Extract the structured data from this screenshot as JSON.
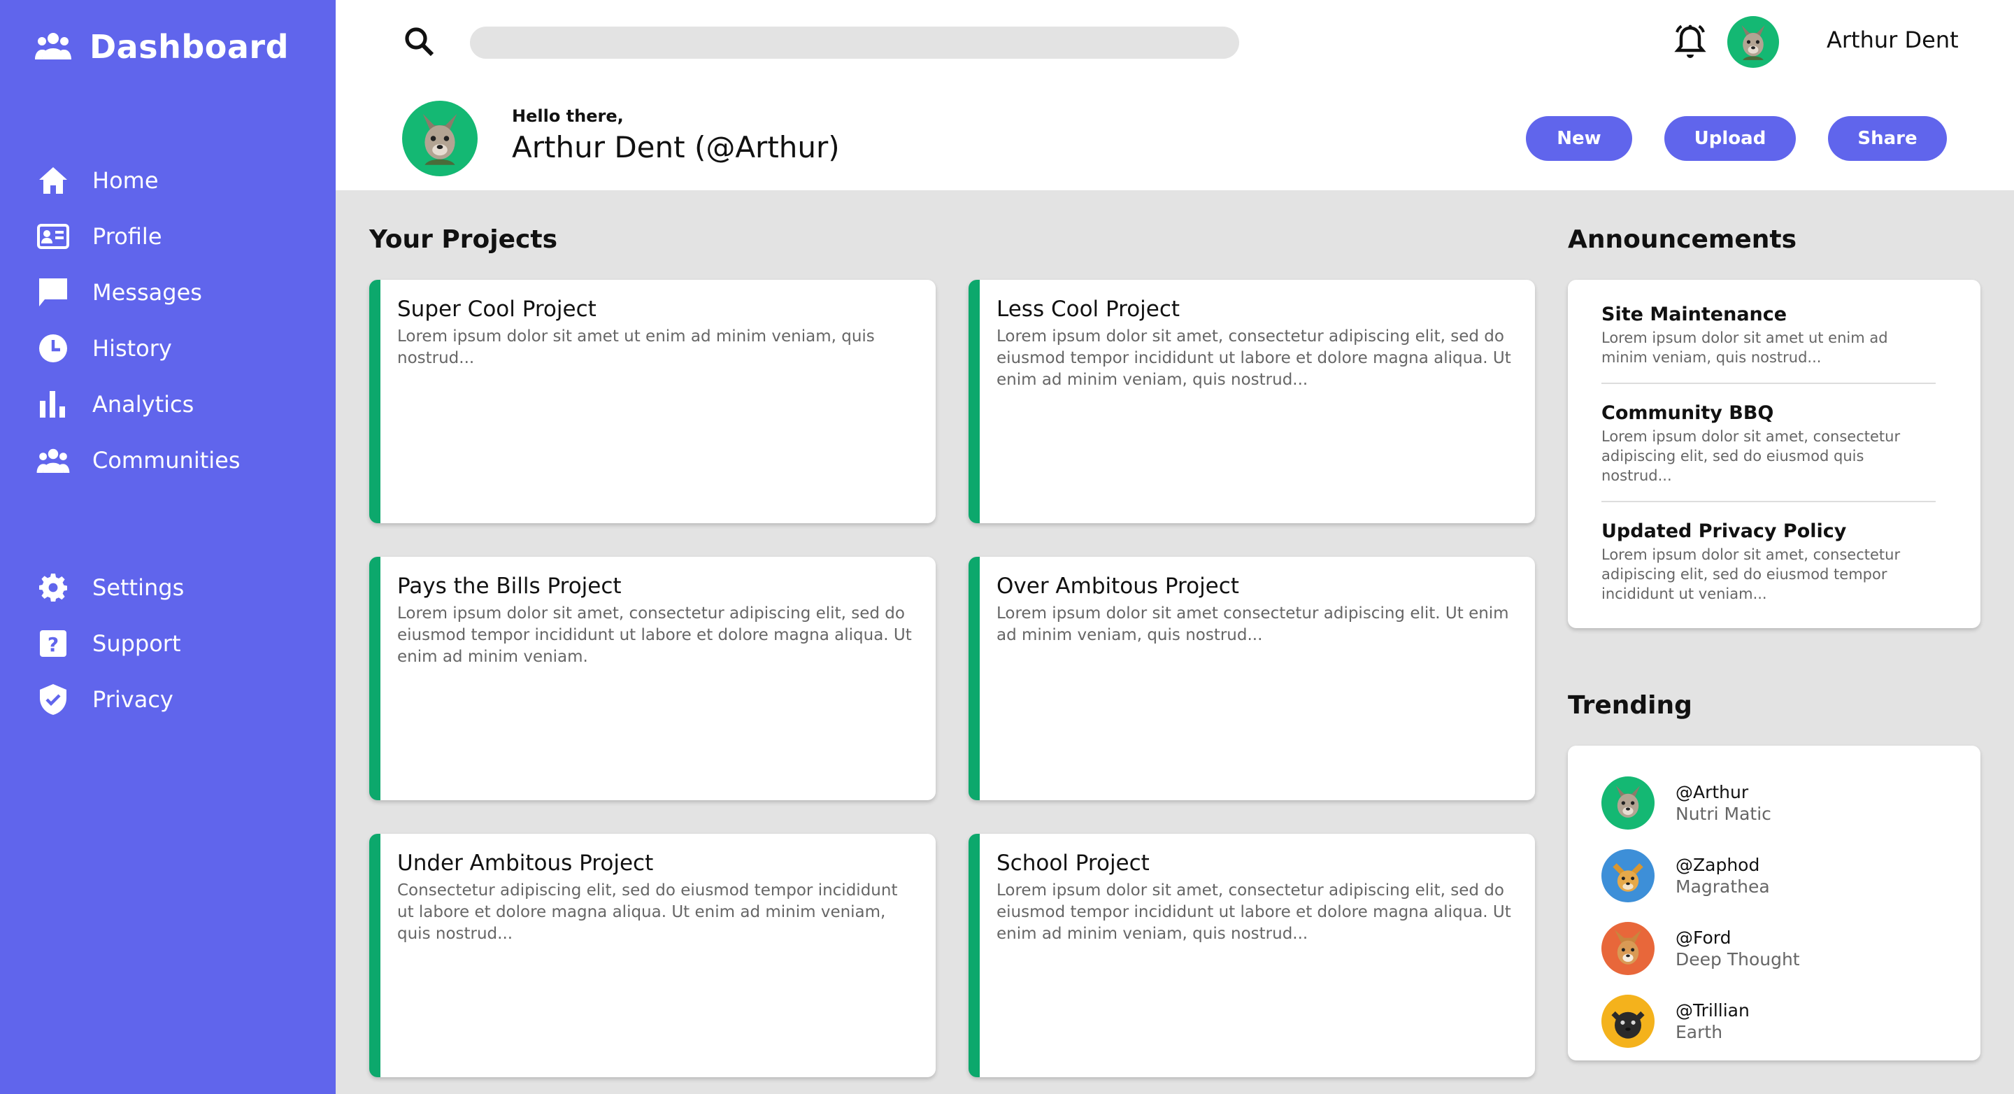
{
  "sidebar": {
    "brand": "Dashboard",
    "nav_top": [
      {
        "label": "Home",
        "icon": "home-icon"
      },
      {
        "label": "Profile",
        "icon": "profile-card-icon"
      },
      {
        "label": "Messages",
        "icon": "message-icon"
      },
      {
        "label": "History",
        "icon": "clock-icon"
      },
      {
        "label": "Analytics",
        "icon": "bar-chart-icon"
      },
      {
        "label": "Communities",
        "icon": "people-icon"
      }
    ],
    "nav_bottom": [
      {
        "label": "Settings",
        "icon": "gear-icon"
      },
      {
        "label": "Support",
        "icon": "help-icon"
      },
      {
        "label": "Privacy",
        "icon": "shield-icon"
      }
    ]
  },
  "header": {
    "search_placeholder": "",
    "username": "Arthur Dent",
    "greeting": "Hello there,",
    "full_name": "Arthur Dent (@Arthur)",
    "buttons": {
      "new": "New",
      "upload": "Upload",
      "share": "Share"
    }
  },
  "projects": {
    "title": "Your Projects",
    "items": [
      {
        "title": "Super Cool Project",
        "desc": "Lorem ipsum dolor sit amet ut enim ad minim veniam, quis nostrud..."
      },
      {
        "title": "Less Cool Project",
        "desc": "Lorem ipsum dolor sit amet, consectetur adipiscing elit, sed do eiusmod tempor incididunt ut labore et dolore magna aliqua. Ut enim ad minim veniam, quis nostrud..."
      },
      {
        "title": "Pays the Bills Project",
        "desc": "Lorem ipsum dolor sit amet, consectetur adipiscing elit, sed do eiusmod tempor incididunt ut labore et dolore magna aliqua. Ut enim ad minim veniam."
      },
      {
        "title": "Over Ambitous Project",
        "desc": "Lorem ipsum dolor sit amet consectetur adipiscing elit. Ut enim ad minim veniam, quis nostrud..."
      },
      {
        "title": "Under Ambitous Project",
        "desc": "Consectetur adipiscing elit, sed do eiusmod tempor incididunt ut labore et dolore magna aliqua. Ut enim ad minim veniam, quis nostrud..."
      },
      {
        "title": "School Project",
        "desc": "Lorem ipsum dolor sit amet, consectetur adipiscing elit, sed do eiusmod tempor incididunt ut labore et dolore magna aliqua. Ut enim ad minim veniam, quis nostrud..."
      }
    ]
  },
  "announcements": {
    "title": "Announcements",
    "items": [
      {
        "title": "Site Maintenance",
        "desc": "Lorem ipsum dolor sit amet ut enim ad minim veniam, quis nostrud..."
      },
      {
        "title": "Community BBQ",
        "desc": "Lorem ipsum dolor sit amet, consectetur adipiscing elit, sed do eiusmod quis nostrud..."
      },
      {
        "title": "Updated Privacy Policy",
        "desc": "Lorem ipsum dolor sit amet, consectetur adipiscing elit, sed do eiusmod tempor incididunt ut veniam..."
      }
    ]
  },
  "trending": {
    "title": "Trending",
    "items": [
      {
        "handle": "@Arthur",
        "sub": "Nutri Matic",
        "avatar_color": "#14b873"
      },
      {
        "handle": "@Zaphod",
        "sub": "Magrathea",
        "avatar_color": "#3d8fd8"
      },
      {
        "handle": "@Ford",
        "sub": "Deep Thought",
        "avatar_color": "#e8673a"
      },
      {
        "handle": "@Trillian",
        "sub": "Earth",
        "avatar_color": "#f4b21c"
      }
    ]
  },
  "colors": {
    "accent": "#6065ec",
    "card_accent": "#0ca86c",
    "background": "#e3e3e3"
  }
}
